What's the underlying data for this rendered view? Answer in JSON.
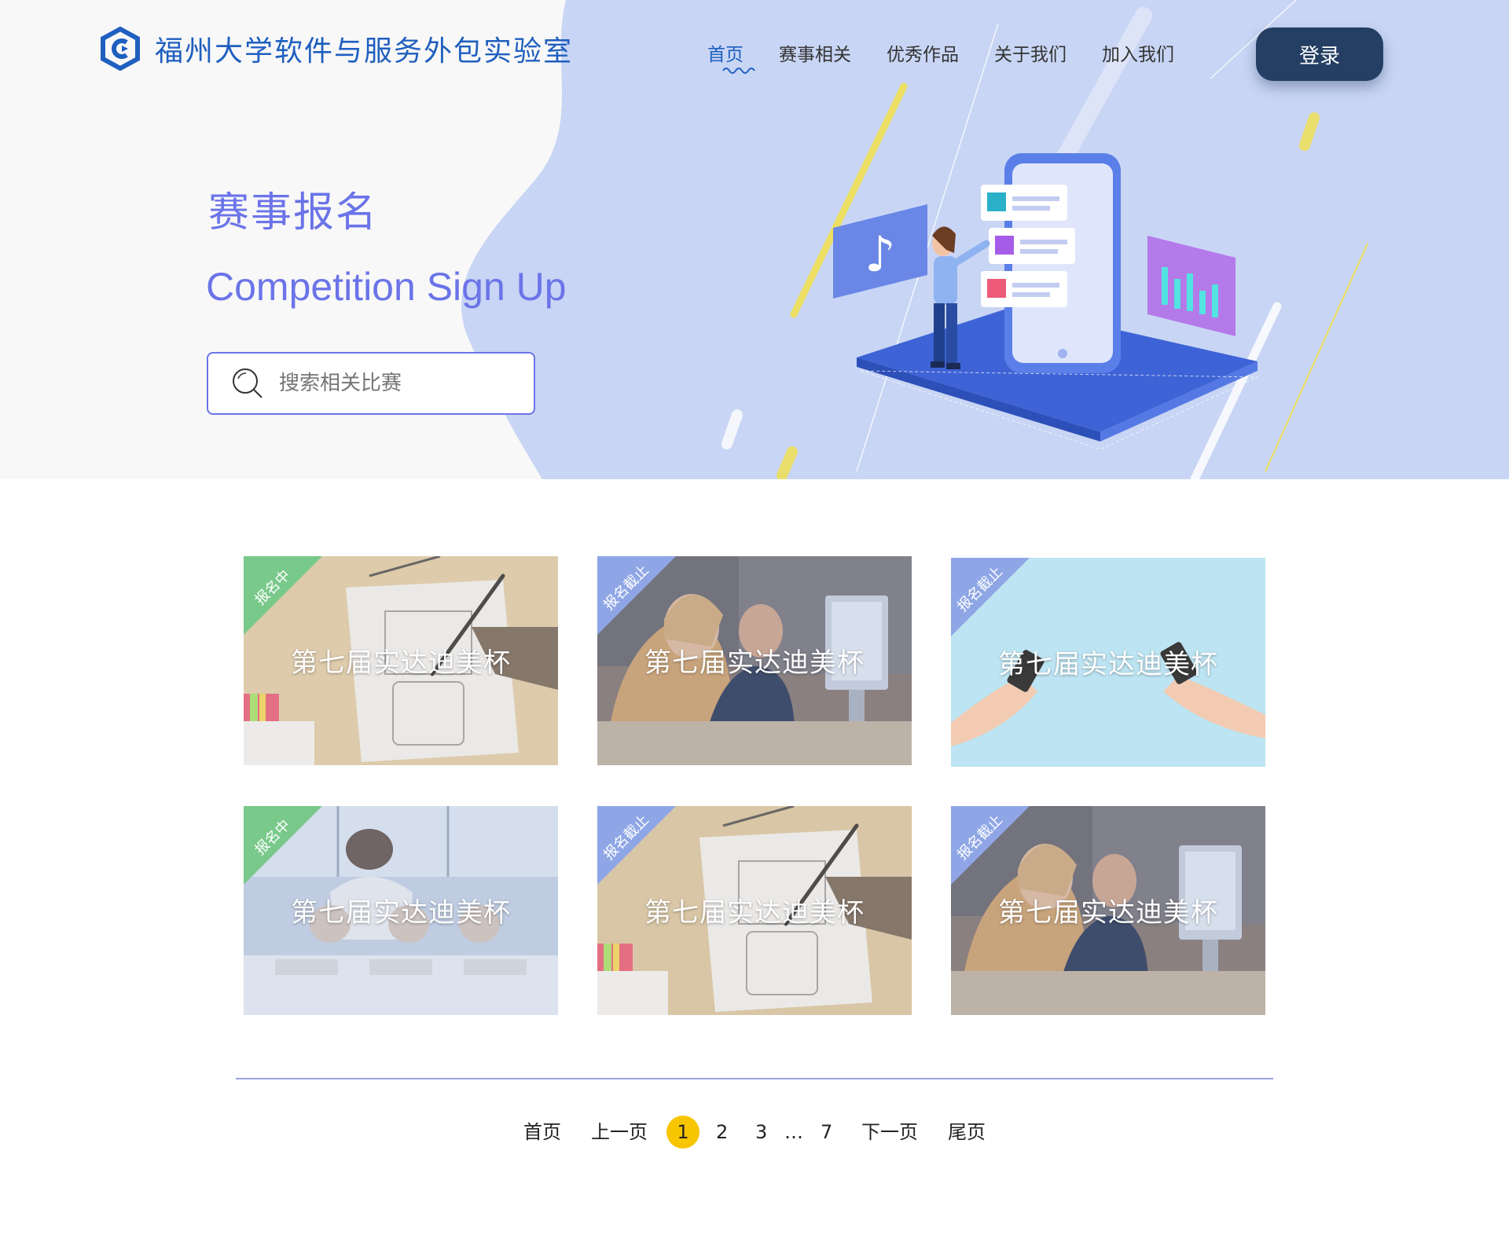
{
  "header": {
    "logo_text": "福州大学软件与服务外包实验室",
    "nav": [
      "首页",
      "赛事相关",
      "优秀作品",
      "关于我们",
      "加入我们"
    ],
    "active_nav": "首页",
    "login_label": "登录"
  },
  "hero": {
    "title": "赛事报名",
    "subtitle": "Competition Sign Up",
    "search_placeholder": "搜索相关比赛"
  },
  "cards": [
    {
      "title": "第七届实达迪美杯",
      "status": "报名中",
      "image": "design-sketch"
    },
    {
      "title": "第七届实达迪美杯",
      "status": "报名截止",
      "image": "office-team"
    },
    {
      "title": "第七届实达迪美杯",
      "status": "报名截止",
      "image": "phones-hands"
    },
    {
      "title": "第七届实达迪美杯",
      "status": "报名中",
      "image": "team-desks"
    },
    {
      "title": "第七届实达迪美杯",
      "status": "报名截止",
      "image": "design-sketch"
    },
    {
      "title": "第七届实达迪美杯",
      "status": "报名截止",
      "image": "office-team"
    }
  ],
  "pagination": {
    "first": "首页",
    "prev": "上一页",
    "pages": [
      "1",
      "2",
      "3"
    ],
    "ellipsis": "…",
    "last_page": "7",
    "next": "下一页",
    "last": "尾页",
    "current": "1"
  },
  "colors": {
    "brand_blue": "#1f5fbf",
    "accent_purple": "#6b74e8",
    "hero_blue": "#c8d5f4",
    "login_bg": "#243f63",
    "status_open": "#79c98a",
    "status_closed": "#8fa6e6",
    "current_page": "#f7c600"
  }
}
